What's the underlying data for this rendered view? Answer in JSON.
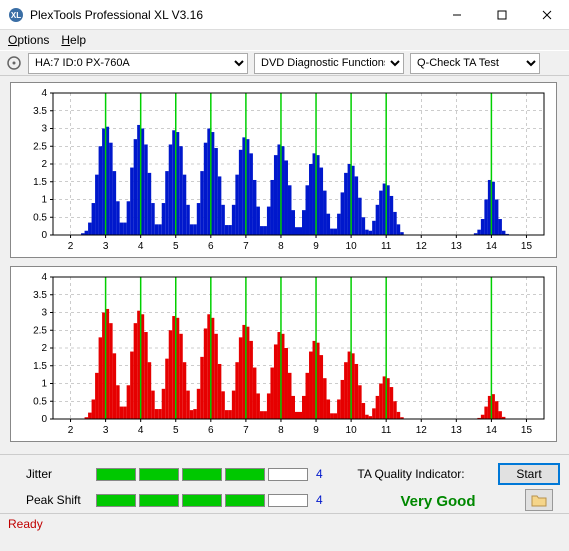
{
  "window": {
    "title": "PlexTools Professional XL V3.16"
  },
  "menu": {
    "options": "Options",
    "help": "Help"
  },
  "toolbar": {
    "device": "HA:7 ID:0   PX-760A",
    "func": "DVD Diagnostic Functions",
    "test": "Q-Check TA Test"
  },
  "indicators": {
    "jitter_label": "Jitter",
    "jitter_value": "4",
    "peak_label": "Peak Shift",
    "peak_value": "4",
    "ta_label": "TA Quality Indicator:",
    "ta_value": "Very Good",
    "start_label": "Start"
  },
  "status": "Ready",
  "chart_data": [
    {
      "type": "bar",
      "color": "#0018cc",
      "xlim": [
        1.5,
        15.5
      ],
      "ylim": [
        0,
        4
      ],
      "yticks": [
        0,
        0.5,
        1,
        1.5,
        2,
        2.5,
        3,
        3.5,
        4
      ],
      "xticks": [
        2,
        3,
        4,
        5,
        6,
        7,
        8,
        9,
        10,
        11,
        12,
        13,
        14,
        15
      ],
      "vlines": [
        3,
        4,
        5,
        6,
        7,
        8,
        9,
        10,
        11,
        14
      ],
      "bins": [
        {
          "x": 2.35,
          "y": 0.05
        },
        {
          "x": 2.45,
          "y": 0.12
        },
        {
          "x": 2.55,
          "y": 0.35
        },
        {
          "x": 2.65,
          "y": 0.9
        },
        {
          "x": 2.75,
          "y": 1.7
        },
        {
          "x": 2.85,
          "y": 2.5
        },
        {
          "x": 2.95,
          "y": 3.0
        },
        {
          "x": 3.05,
          "y": 3.05
        },
        {
          "x": 3.15,
          "y": 2.6
        },
        {
          "x": 3.25,
          "y": 1.8
        },
        {
          "x": 3.35,
          "y": 0.95
        },
        {
          "x": 3.45,
          "y": 0.35
        },
        {
          "x": 3.55,
          "y": 0.35
        },
        {
          "x": 3.65,
          "y": 0.95
        },
        {
          "x": 3.75,
          "y": 1.9
        },
        {
          "x": 3.85,
          "y": 2.7
        },
        {
          "x": 3.95,
          "y": 3.1
        },
        {
          "x": 4.05,
          "y": 3.0
        },
        {
          "x": 4.15,
          "y": 2.55
        },
        {
          "x": 4.25,
          "y": 1.75
        },
        {
          "x": 4.35,
          "y": 0.9
        },
        {
          "x": 4.45,
          "y": 0.3
        },
        {
          "x": 4.55,
          "y": 0.3
        },
        {
          "x": 4.65,
          "y": 0.9
        },
        {
          "x": 4.75,
          "y": 1.8
        },
        {
          "x": 4.85,
          "y": 2.55
        },
        {
          "x": 4.95,
          "y": 2.95
        },
        {
          "x": 5.05,
          "y": 2.9
        },
        {
          "x": 5.15,
          "y": 2.5
        },
        {
          "x": 5.25,
          "y": 1.7
        },
        {
          "x": 5.35,
          "y": 0.85
        },
        {
          "x": 5.45,
          "y": 0.3
        },
        {
          "x": 5.55,
          "y": 0.3
        },
        {
          "x": 5.65,
          "y": 0.9
        },
        {
          "x": 5.75,
          "y": 1.8
        },
        {
          "x": 5.85,
          "y": 2.6
        },
        {
          "x": 5.95,
          "y": 3.0
        },
        {
          "x": 6.05,
          "y": 2.9
        },
        {
          "x": 6.15,
          "y": 2.45
        },
        {
          "x": 6.25,
          "y": 1.65
        },
        {
          "x": 6.35,
          "y": 0.85
        },
        {
          "x": 6.45,
          "y": 0.28
        },
        {
          "x": 6.55,
          "y": 0.28
        },
        {
          "x": 6.65,
          "y": 0.85
        },
        {
          "x": 6.75,
          "y": 1.7
        },
        {
          "x": 6.85,
          "y": 2.4
        },
        {
          "x": 6.95,
          "y": 2.75
        },
        {
          "x": 7.05,
          "y": 2.7
        },
        {
          "x": 7.15,
          "y": 2.3
        },
        {
          "x": 7.25,
          "y": 1.55
        },
        {
          "x": 7.35,
          "y": 0.8
        },
        {
          "x": 7.45,
          "y": 0.25
        },
        {
          "x": 7.55,
          "y": 0.25
        },
        {
          "x": 7.65,
          "y": 0.8
        },
        {
          "x": 7.75,
          "y": 1.55
        },
        {
          "x": 7.85,
          "y": 2.25
        },
        {
          "x": 7.95,
          "y": 2.55
        },
        {
          "x": 8.05,
          "y": 2.5
        },
        {
          "x": 8.15,
          "y": 2.1
        },
        {
          "x": 8.25,
          "y": 1.4
        },
        {
          "x": 8.35,
          "y": 0.7
        },
        {
          "x": 8.45,
          "y": 0.22
        },
        {
          "x": 8.55,
          "y": 0.22
        },
        {
          "x": 8.65,
          "y": 0.7
        },
        {
          "x": 8.75,
          "y": 1.4
        },
        {
          "x": 8.85,
          "y": 2.0
        },
        {
          "x": 8.95,
          "y": 2.3
        },
        {
          "x": 9.05,
          "y": 2.25
        },
        {
          "x": 9.15,
          "y": 1.9
        },
        {
          "x": 9.25,
          "y": 1.25
        },
        {
          "x": 9.35,
          "y": 0.6
        },
        {
          "x": 9.45,
          "y": 0.18
        },
        {
          "x": 9.55,
          "y": 0.18
        },
        {
          "x": 9.65,
          "y": 0.6
        },
        {
          "x": 9.75,
          "y": 1.2
        },
        {
          "x": 9.85,
          "y": 1.75
        },
        {
          "x": 9.95,
          "y": 2.0
        },
        {
          "x": 10.05,
          "y": 1.95
        },
        {
          "x": 10.15,
          "y": 1.65
        },
        {
          "x": 10.25,
          "y": 1.05
        },
        {
          "x": 10.35,
          "y": 0.5
        },
        {
          "x": 10.45,
          "y": 0.15
        },
        {
          "x": 10.55,
          "y": 0.12
        },
        {
          "x": 10.65,
          "y": 0.4
        },
        {
          "x": 10.75,
          "y": 0.85
        },
        {
          "x": 10.85,
          "y": 1.25
        },
        {
          "x": 10.95,
          "y": 1.45
        },
        {
          "x": 11.05,
          "y": 1.4
        },
        {
          "x": 11.15,
          "y": 1.1
        },
        {
          "x": 11.25,
          "y": 0.65
        },
        {
          "x": 11.35,
          "y": 0.3
        },
        {
          "x": 11.45,
          "y": 0.08
        },
        {
          "x": 13.55,
          "y": 0.05
        },
        {
          "x": 13.65,
          "y": 0.15
        },
        {
          "x": 13.75,
          "y": 0.45
        },
        {
          "x": 13.85,
          "y": 1.0
        },
        {
          "x": 13.95,
          "y": 1.55
        },
        {
          "x": 14.05,
          "y": 1.5
        },
        {
          "x": 14.15,
          "y": 1.0
        },
        {
          "x": 14.25,
          "y": 0.45
        },
        {
          "x": 14.35,
          "y": 0.12
        },
        {
          "x": 14.45,
          "y": 0.03
        }
      ]
    },
    {
      "type": "bar",
      "color": "#e60000",
      "xlim": [
        1.5,
        15.5
      ],
      "ylim": [
        0,
        4
      ],
      "yticks": [
        0,
        0.5,
        1,
        1.5,
        2,
        2.5,
        3,
        3.5,
        4
      ],
      "xticks": [
        2,
        3,
        4,
        5,
        6,
        7,
        8,
        9,
        10,
        11,
        12,
        13,
        14,
        15
      ],
      "vlines": [
        3,
        4,
        5,
        6,
        7,
        8,
        9,
        10,
        11,
        14
      ],
      "bins": [
        {
          "x": 2.45,
          "y": 0.05
        },
        {
          "x": 2.55,
          "y": 0.18
        },
        {
          "x": 2.65,
          "y": 0.55
        },
        {
          "x": 2.75,
          "y": 1.3
        },
        {
          "x": 2.85,
          "y": 2.3
        },
        {
          "x": 2.95,
          "y": 3.0
        },
        {
          "x": 3.05,
          "y": 3.1
        },
        {
          "x": 3.15,
          "y": 2.7
        },
        {
          "x": 3.25,
          "y": 1.85
        },
        {
          "x": 3.35,
          "y": 0.95
        },
        {
          "x": 3.45,
          "y": 0.35
        },
        {
          "x": 3.55,
          "y": 0.35
        },
        {
          "x": 3.65,
          "y": 0.95
        },
        {
          "x": 3.75,
          "y": 1.9
        },
        {
          "x": 3.85,
          "y": 2.7
        },
        {
          "x": 3.95,
          "y": 3.05
        },
        {
          "x": 4.05,
          "y": 2.95
        },
        {
          "x": 4.15,
          "y": 2.45
        },
        {
          "x": 4.25,
          "y": 1.6
        },
        {
          "x": 4.35,
          "y": 0.8
        },
        {
          "x": 4.45,
          "y": 0.28
        },
        {
          "x": 4.55,
          "y": 0.28
        },
        {
          "x": 4.65,
          "y": 0.85
        },
        {
          "x": 4.75,
          "y": 1.7
        },
        {
          "x": 4.85,
          "y": 2.5
        },
        {
          "x": 4.95,
          "y": 2.9
        },
        {
          "x": 5.05,
          "y": 2.85
        },
        {
          "x": 5.15,
          "y": 2.4
        },
        {
          "x": 5.25,
          "y": 1.6
        },
        {
          "x": 5.35,
          "y": 0.8
        },
        {
          "x": 5.45,
          "y": 0.25
        },
        {
          "x": 5.55,
          "y": 0.28
        },
        {
          "x": 5.65,
          "y": 0.85
        },
        {
          "x": 5.75,
          "y": 1.75
        },
        {
          "x": 5.85,
          "y": 2.55
        },
        {
          "x": 5.95,
          "y": 2.95
        },
        {
          "x": 6.05,
          "y": 2.85
        },
        {
          "x": 6.15,
          "y": 2.4
        },
        {
          "x": 6.25,
          "y": 1.55
        },
        {
          "x": 6.35,
          "y": 0.78
        },
        {
          "x": 6.45,
          "y": 0.25
        },
        {
          "x": 6.55,
          "y": 0.25
        },
        {
          "x": 6.65,
          "y": 0.8
        },
        {
          "x": 6.75,
          "y": 1.6
        },
        {
          "x": 6.85,
          "y": 2.3
        },
        {
          "x": 6.95,
          "y": 2.65
        },
        {
          "x": 7.05,
          "y": 2.6
        },
        {
          "x": 7.15,
          "y": 2.2
        },
        {
          "x": 7.25,
          "y": 1.45
        },
        {
          "x": 7.35,
          "y": 0.72
        },
        {
          "x": 7.45,
          "y": 0.22
        },
        {
          "x": 7.55,
          "y": 0.22
        },
        {
          "x": 7.65,
          "y": 0.72
        },
        {
          "x": 7.75,
          "y": 1.45
        },
        {
          "x": 7.85,
          "y": 2.1
        },
        {
          "x": 7.95,
          "y": 2.45
        },
        {
          "x": 8.05,
          "y": 2.4
        },
        {
          "x": 8.15,
          "y": 2.0
        },
        {
          "x": 8.25,
          "y": 1.3
        },
        {
          "x": 8.35,
          "y": 0.65
        },
        {
          "x": 8.45,
          "y": 0.2
        },
        {
          "x": 8.55,
          "y": 0.2
        },
        {
          "x": 8.65,
          "y": 0.65
        },
        {
          "x": 8.75,
          "y": 1.3
        },
        {
          "x": 8.85,
          "y": 1.9
        },
        {
          "x": 8.95,
          "y": 2.2
        },
        {
          "x": 9.05,
          "y": 2.15
        },
        {
          "x": 9.15,
          "y": 1.8
        },
        {
          "x": 9.25,
          "y": 1.15
        },
        {
          "x": 9.35,
          "y": 0.55
        },
        {
          "x": 9.45,
          "y": 0.16
        },
        {
          "x": 9.55,
          "y": 0.16
        },
        {
          "x": 9.65,
          "y": 0.55
        },
        {
          "x": 9.75,
          "y": 1.1
        },
        {
          "x": 9.85,
          "y": 1.6
        },
        {
          "x": 9.95,
          "y": 1.9
        },
        {
          "x": 10.05,
          "y": 1.85
        },
        {
          "x": 10.15,
          "y": 1.55
        },
        {
          "x": 10.25,
          "y": 0.95
        },
        {
          "x": 10.35,
          "y": 0.45
        },
        {
          "x": 10.45,
          "y": 0.12
        },
        {
          "x": 10.55,
          "y": 0.08
        },
        {
          "x": 10.65,
          "y": 0.3
        },
        {
          "x": 10.75,
          "y": 0.65
        },
        {
          "x": 10.85,
          "y": 1.0
        },
        {
          "x": 10.95,
          "y": 1.2
        },
        {
          "x": 11.05,
          "y": 1.15
        },
        {
          "x": 11.15,
          "y": 0.9
        },
        {
          "x": 11.25,
          "y": 0.5
        },
        {
          "x": 11.35,
          "y": 0.2
        },
        {
          "x": 11.45,
          "y": 0.05
        },
        {
          "x": 13.65,
          "y": 0.03
        },
        {
          "x": 13.75,
          "y": 0.12
        },
        {
          "x": 13.85,
          "y": 0.35
        },
        {
          "x": 13.95,
          "y": 0.65
        },
        {
          "x": 14.05,
          "y": 0.7
        },
        {
          "x": 14.15,
          "y": 0.5
        },
        {
          "x": 14.25,
          "y": 0.22
        },
        {
          "x": 14.35,
          "y": 0.06
        }
      ]
    }
  ]
}
